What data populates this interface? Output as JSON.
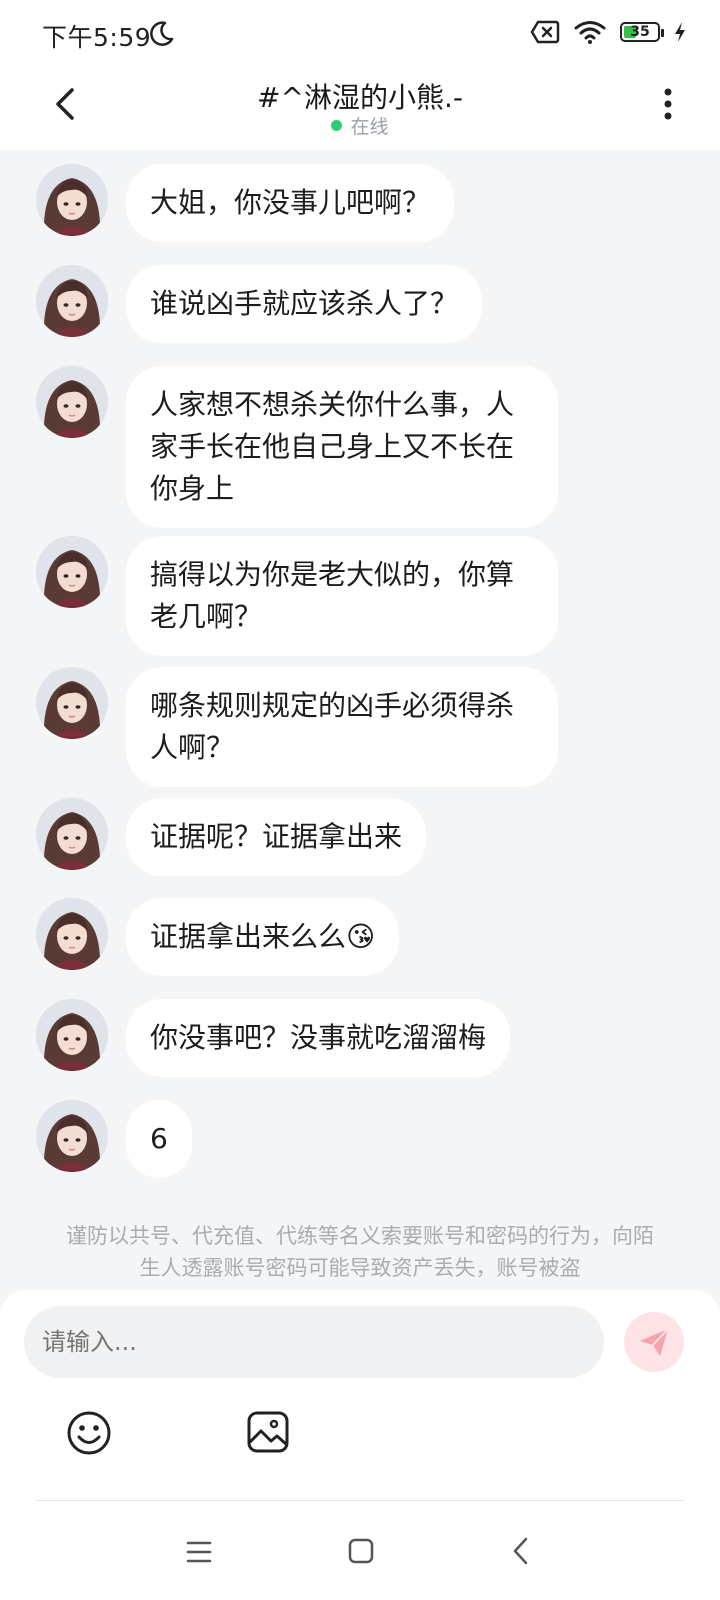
{
  "status_bar": {
    "time": "下午5:59",
    "battery": "35"
  },
  "header": {
    "title": "#^淋湿的小熊.-",
    "status": "在线"
  },
  "messages": [
    {
      "text": "大姐，你没事儿吧啊？"
    },
    {
      "text": "谁说凶手就应该杀人了？"
    },
    {
      "text": "人家想不想杀关你什么事，人家手长在他自己身上又不长在你身上"
    },
    {
      "text": "搞得以为你是老大似的，你算老几啊？"
    },
    {
      "text": "哪条规则规定的凶手必须得杀人啊？"
    },
    {
      "text": "证据呢？证据拿出来"
    },
    {
      "text": "证据拿出来么么😘"
    },
    {
      "text": "你没事吧？没事就吃溜溜梅"
    },
    {
      "text": "6"
    }
  ],
  "notice": "谨防以共号、代充值、代练等名义索要账号和密码的行为，向陌生人透露账号密码可能导致资产丢失，账号被盗",
  "input": {
    "placeholder": "请输入..."
  },
  "colors": {
    "online": "#2ecc71",
    "send_button_bg": "#fde3e5",
    "send_icon": "#f4a3a8"
  },
  "icons": [
    "back-icon",
    "more-icon",
    "moon-icon",
    "sim-off-icon",
    "wifi-icon",
    "battery-icon",
    "charging-icon",
    "send-icon",
    "emoji-icon",
    "image-icon",
    "menu-icon",
    "home-icon",
    "nav-back-icon"
  ]
}
